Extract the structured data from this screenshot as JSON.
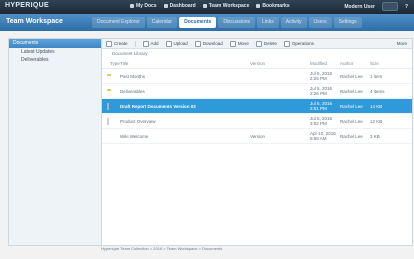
{
  "topbar": {
    "brand": "HYPERIQUE",
    "links": [
      {
        "label": "My Docs"
      },
      {
        "label": "Dashboard"
      },
      {
        "label": "Team Workspace"
      },
      {
        "label": "Bookmarks"
      }
    ],
    "user": "Modern User",
    "utility": "?"
  },
  "navbar": {
    "workspace_title": "Team Workspace",
    "tabs": [
      {
        "label": "Document Explorer",
        "active": false
      },
      {
        "label": "Calendar",
        "active": false
      },
      {
        "label": "Documents",
        "active": true
      },
      {
        "label": "Discussions",
        "active": false
      },
      {
        "label": "Links",
        "active": false
      },
      {
        "label": "Activity",
        "active": false
      },
      {
        "label": "Users",
        "active": false
      },
      {
        "label": "Settings",
        "active": false
      }
    ]
  },
  "sidebar": {
    "header": "Documents",
    "items": [
      {
        "label": "Latest Updates"
      },
      {
        "label": "Deliverables"
      }
    ]
  },
  "toolbar": {
    "items": [
      {
        "label": "Create"
      },
      {
        "label": "Add"
      },
      {
        "label": "Upload"
      },
      {
        "label": "Download"
      },
      {
        "label": "Move"
      },
      {
        "label": "Delete"
      },
      {
        "label": "Operations"
      }
    ],
    "more": "More"
  },
  "breadcrumb": "Document Library",
  "table": {
    "headers": [
      "Type",
      "Title",
      "Version",
      "Modified",
      "Author",
      "Size"
    ],
    "rows": [
      {
        "icon": "folder",
        "title": "Past Months",
        "version": "",
        "modified": "Jul 5, 2016 2:25 PM",
        "author": "Rachel Lee",
        "size": "1 item",
        "selected": false
      },
      {
        "icon": "folder",
        "title": "Deliverables",
        "version": "",
        "modified": "Jul 5, 2016 2:26 PM",
        "author": "Rachel Lee",
        "size": "4 items",
        "selected": false
      },
      {
        "icon": "doc",
        "title": "Draft Report Documents Version 02",
        "version": "",
        "modified": "Jul 5, 2016 2:51 PM",
        "author": "Rachel Lee",
        "size": "14 KB",
        "selected": true
      },
      {
        "icon": "doc-light",
        "title": "Product Overview",
        "version": "",
        "modified": "Jul 5, 2016 3:52 PM",
        "author": "Rachel Lee",
        "size": "12 KB",
        "selected": false
      },
      {
        "icon": "notebook",
        "title": "Wiki Welcome",
        "version": "Version",
        "modified": "Apr 10, 2016 9:58 AM",
        "author": "Rachel Lee",
        "size": "3 KB",
        "selected": false
      }
    ]
  },
  "status": "Hyperique Team Collection > 2016 > Team Workspace > Documents"
}
